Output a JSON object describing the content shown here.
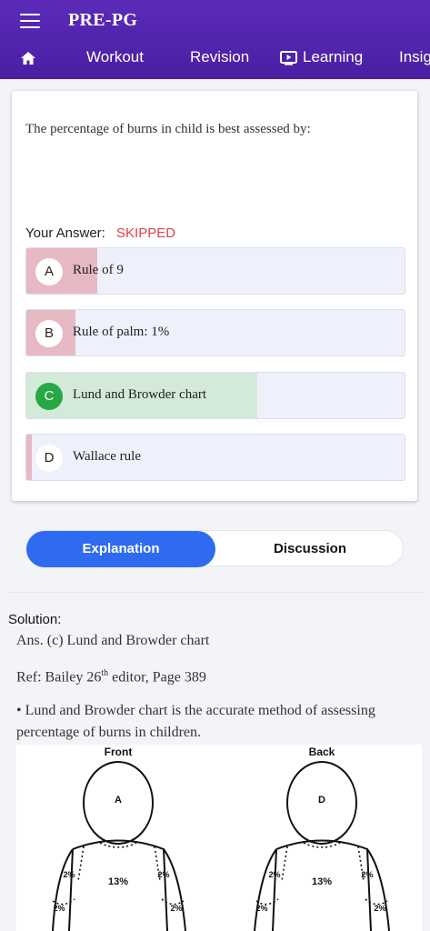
{
  "app": {
    "title": "PRE-PG"
  },
  "nav": {
    "tabs": [
      {
        "label": "Workout"
      },
      {
        "label": "Revision"
      },
      {
        "label": "Learning"
      },
      {
        "label": "Insig"
      }
    ]
  },
  "question": {
    "text": "The percentage of burns in child is best assessed by:",
    "your_answer_label": "Your Answer:",
    "your_answer_value": "SKIPPED",
    "options": [
      {
        "letter": "A",
        "text": "Rule of 9",
        "percent_bar": 0.19,
        "state": "wrong"
      },
      {
        "letter": "B",
        "text": "Rule of palm: 1%",
        "percent_bar": 0.13,
        "state": "wrong"
      },
      {
        "letter": "C",
        "text": "Lund and Browder chart",
        "percent_bar": 0.61,
        "state": "correct"
      },
      {
        "letter": "D",
        "text": "Wallace rule",
        "percent_bar": 0.04,
        "state": "wrong"
      }
    ]
  },
  "segmented": {
    "explanation": "Explanation",
    "discussion": "Discussion",
    "active": "Explanation"
  },
  "solution": {
    "label": "Solution:",
    "ans": "Ans. (c) Lund and Browder chart",
    "ref_prefix": "Ref: Bailey 26",
    "ref_sup": "th",
    "ref_suffix": " editor, Page 389",
    "bullet": "• Lund and Browder chart is the accurate method of assessing percentage of burns in children."
  },
  "figure": {
    "front_label": "Front",
    "back_label": "Back",
    "front_head": "A",
    "back_head": "D",
    "chest": "13%",
    "arm": "2%"
  },
  "colors": {
    "appbar": "#4a1fa3",
    "wrong_fill": "#e7b9c2",
    "correct_fill": "#d3ead8",
    "correct_badge": "#28a745",
    "skipped": "#e0404a",
    "tab_active": "#2f6bf0"
  },
  "icons": {
    "menu": "menu-icon",
    "home": "home-icon",
    "learning": "video-play-icon"
  }
}
